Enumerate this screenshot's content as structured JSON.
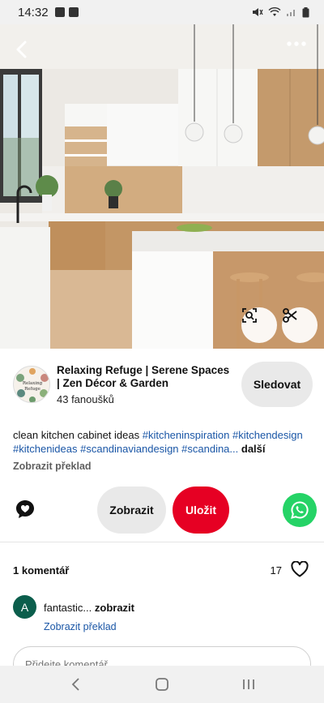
{
  "status_bar": {
    "time": "14:32"
  },
  "creator": {
    "name": "Relaxing Refuge | Serene Spaces | Zen Décor & Garden",
    "followers": "43 fanoušků",
    "follow_label": "Sledovat",
    "avatar_text": "Relaxing Refuge"
  },
  "description": {
    "text": "clean kitchen cabinet ideas ",
    "tags": "#kitcheninspiration #kitchendesign #kitchenideas #scandinaviandesign #scandina...",
    "more": "další"
  },
  "translate_label": "Zobrazit překlad",
  "actions": {
    "view_label": "Zobrazit",
    "save_label": "Uložit"
  },
  "comments": {
    "count_label": "1 komentář",
    "likes": "17",
    "items": [
      {
        "avatar": "A",
        "text": "fantastic... ",
        "show": "zobrazit",
        "translate": "Zobrazit překlad"
      }
    ],
    "input_placeholder": "Přidejte komentář"
  },
  "colors": {
    "save": "#e60023",
    "whatsapp": "#25d366",
    "link": "#1a56a6"
  },
  "icons": [
    "back-icon",
    "more-icon",
    "visual-search-icon",
    "scissors-icon",
    "comment-icon",
    "whatsapp-icon",
    "heart-icon"
  ]
}
